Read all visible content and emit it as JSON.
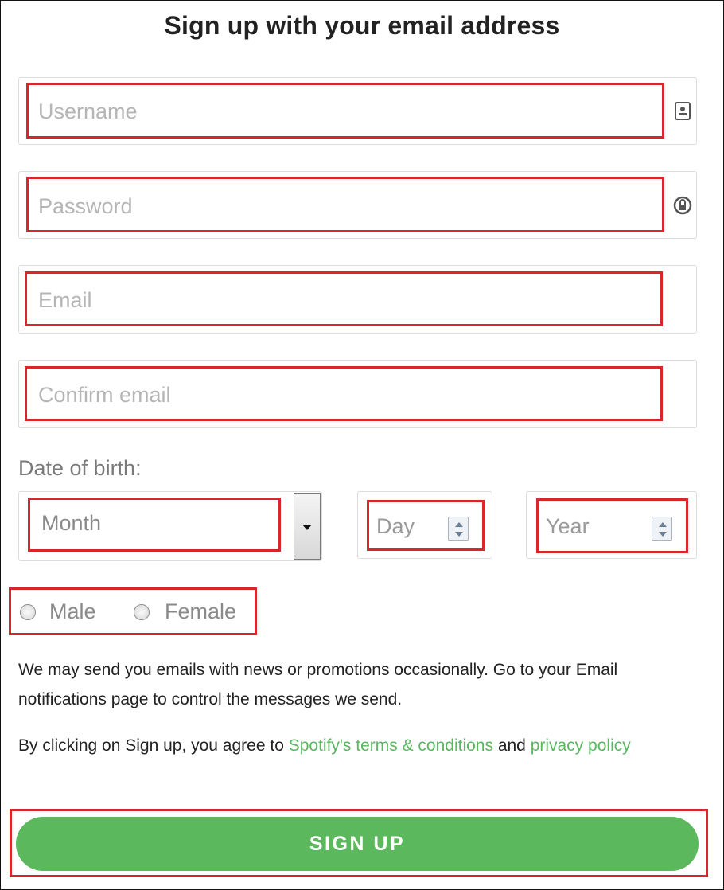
{
  "form": {
    "title": "Sign up with your email address",
    "username_placeholder": "Username",
    "password_placeholder": "Password",
    "email_placeholder": "Email",
    "confirm_email_placeholder": "Confirm email",
    "dob_label": "Date of birth:",
    "month_placeholder": "Month",
    "day_placeholder": "Day",
    "year_placeholder": "Year",
    "gender_options": [
      "Male",
      "Female"
    ],
    "notice_text": "We may send you emails with news or promotions occasionally. Go to your Email notifications page to control the messages we send.",
    "terms_prefix": "By clicking on Sign up, you agree to ",
    "terms_link": "Spotify's terms & conditions",
    "terms_and": " and ",
    "privacy_link": "privacy policy",
    "signup_label": "SIGN UP"
  },
  "icons": {
    "username": "contact-card-icon",
    "password": "password-key-icon",
    "month": "dropdown-arrow-icon",
    "spinner": "spinner-arrows-icon"
  },
  "colors": {
    "accent": "#5cb85c",
    "link": "#58b75f",
    "highlight": "#d9262c",
    "placeholder": "#b5b5b5"
  }
}
